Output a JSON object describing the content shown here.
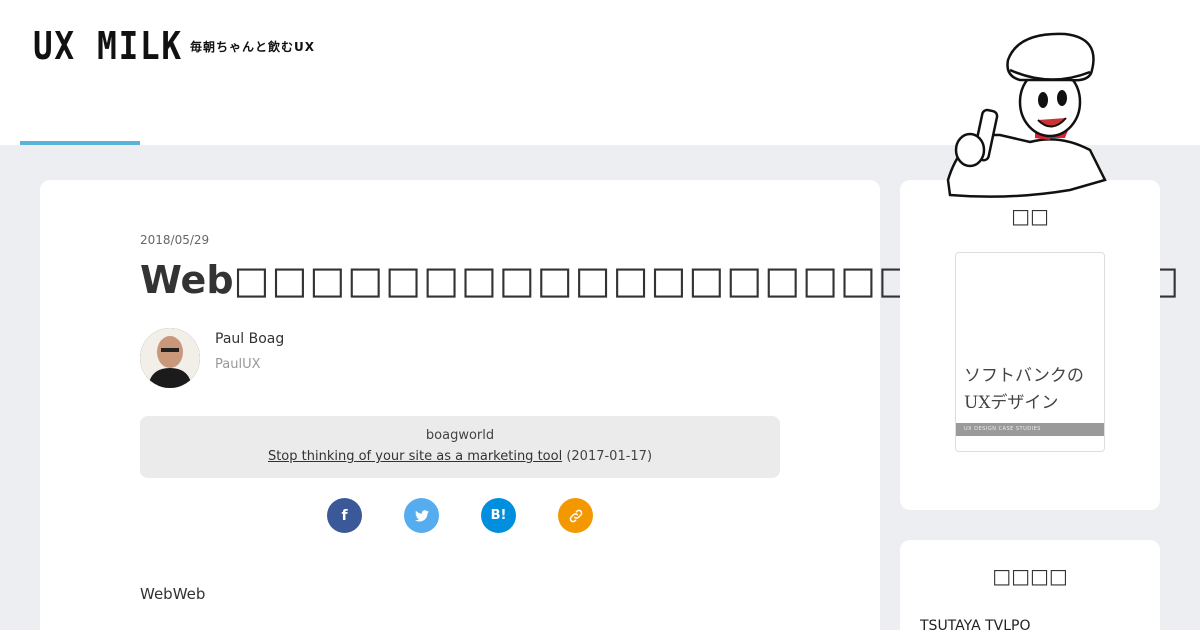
{
  "header": {
    "logo": "UX MILK",
    "tagline": "毎朝ちゃんと飲むUX"
  },
  "article": {
    "date": "2018/05/29",
    "title": "Web",
    "author_name": "Paul Boag",
    "author_sub": "PaulUX",
    "source_site": "boagworld",
    "source_link": "Stop thinking of your site as a marketing tool",
    "source_date": "(2017-01-17)",
    "share": {
      "facebook_icon": "f",
      "twitter_icon": "twitter-bird",
      "hatena_icon": "B!",
      "link_icon": "link"
    },
    "body_text": "WebWeb"
  },
  "sidebar": {
    "book_section_title": "",
    "book_title": "ソフトバンクの\nUXデザイン",
    "book_band": "UX DESIGN CASE STUDIES",
    "ranking_title": "",
    "ranking_item": "TSUTAYA TVLPO"
  },
  "colors": {
    "accent": "#5ab4d8",
    "facebook": "#3b5998",
    "twitter": "#55acee",
    "hatena": "#008fde",
    "link": "#f39800"
  }
}
